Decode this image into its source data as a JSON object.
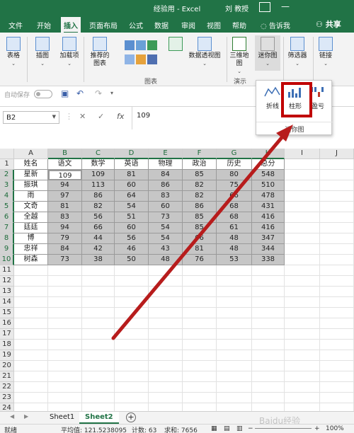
{
  "app": {
    "title": "经验用 - Excel",
    "user": "刘 教授"
  },
  "tabs": [
    "文件",
    "开始",
    "插入",
    "页面布局",
    "公式",
    "数据",
    "审阅",
    "视图",
    "帮助",
    "告诉我"
  ],
  "active_tab": "插入",
  "share": "共享",
  "ribbon": {
    "buttons": [
      {
        "label": "表格"
      },
      {
        "label": "插图"
      },
      {
        "label": "加载项"
      },
      {
        "label": "推荐的图表"
      },
      {
        "label": "数据透视图"
      },
      {
        "label": "三维地图"
      },
      {
        "label": "迷你图"
      },
      {
        "label": "筛选器"
      },
      {
        "label": "链接"
      }
    ],
    "groups": [
      "图表",
      "演示"
    ]
  },
  "qat": {
    "autosave": "自动保存",
    "autosave_state": "关"
  },
  "sparkline_popup": {
    "options": [
      "折线",
      "柱形",
      "盈亏"
    ],
    "group_label": "迷你图"
  },
  "formula_bar": {
    "name_box": "B2",
    "fx": "fx",
    "value": "109"
  },
  "columns": [
    "A",
    "B",
    "C",
    "D",
    "E",
    "F",
    "G",
    "H",
    "I",
    "J"
  ],
  "table": {
    "headers": [
      "姓名",
      "语文",
      "数学",
      "英语",
      "物理",
      "政治",
      "历史",
      "总分"
    ],
    "rows": [
      [
        "星新",
        "109",
        "109",
        "81",
        "84",
        "85",
        "80",
        "548"
      ],
      [
        "振琪",
        "94",
        "113",
        "60",
        "86",
        "82",
        "75",
        "510"
      ],
      [
        "雨",
        "97",
        "86",
        "64",
        "83",
        "82",
        "66",
        "478"
      ],
      [
        "文奇",
        "81",
        "82",
        "54",
        "60",
        "86",
        "68",
        "431"
      ],
      [
        "全越",
        "83",
        "56",
        "51",
        "73",
        "85",
        "68",
        "416"
      ],
      [
        "廷廷",
        "94",
        "66",
        "60",
        "54",
        "85",
        "61",
        "416"
      ],
      [
        "博",
        "79",
        "44",
        "56",
        "54",
        "66",
        "48",
        "347"
      ],
      [
        "忠祥",
        "84",
        "42",
        "46",
        "43",
        "81",
        "48",
        "344"
      ],
      [
        "树森",
        "73",
        "38",
        "50",
        "48",
        "76",
        "53",
        "338"
      ]
    ]
  },
  "sheets": [
    "Sheet1",
    "Sheet2"
  ],
  "active_sheet": "Sheet2",
  "status": {
    "ready": "就绪",
    "average": "平均值: 121.5238095",
    "count": "计数: 63",
    "sum": "求和: 7656",
    "zoom": "100%"
  },
  "watermark": "Baidu经验",
  "colors": {
    "excel_green": "#217346",
    "highlight_red": "#c00000",
    "arrow_red": "#b71c1c",
    "selection_gray": "#c6c6c6"
  },
  "icons": [
    "save-icon",
    "undo-icon",
    "redo-icon",
    "fx-icon",
    "cancel-icon",
    "enter-icon",
    "add-sheet-icon",
    "bulb-icon",
    "share-icon"
  ]
}
